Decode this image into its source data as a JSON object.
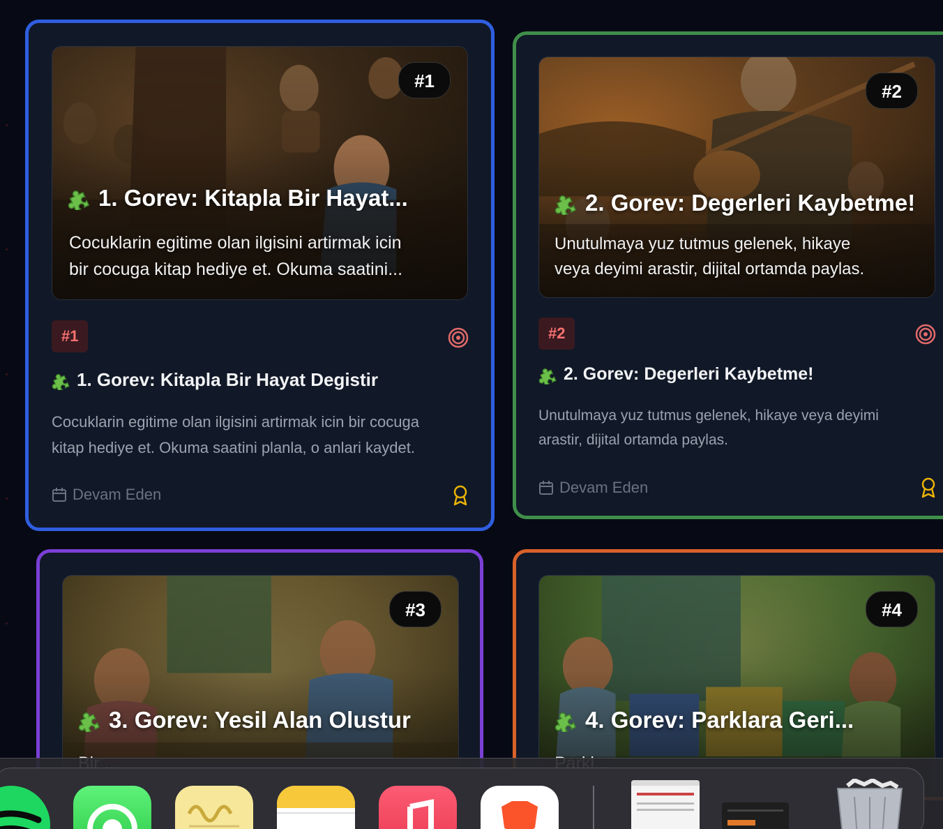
{
  "tasks": [
    {
      "rank": "#1",
      "hero_title": "1. Gorev: Kitapla Bir Hayat...",
      "hero_desc_line1": "Cocuklarin egitime olan ilgisini artirmak icin",
      "hero_desc_line2": "bir cocuga kitap hediye et. Okuma saatini...",
      "tag": "#1",
      "title": "1. Gorev: Kitapla Bir Hayat Degistir",
      "desc_line1": "Cocuklarin egitime olan ilgisini artirmak icin bir cocuga",
      "desc_line2": "kitap hediye et. Okuma saatini planla, o anlari kaydet.",
      "status": "Devam Eden",
      "border_color": "#2f5ee0"
    },
    {
      "rank": "#2",
      "hero_title": "2. Gorev: Degerleri Kaybetme!",
      "hero_desc_line1": "Unutulmaya yuz tutmus gelenek, hikaye",
      "hero_desc_line2": "veya deyimi arastir, dijital ortamda paylas.",
      "tag": "#2",
      "title": "2. Gorev: Degerleri Kaybetme!",
      "desc_line1": "Unutulmaya yuz tutmus gelenek, hikaye veya deyimi",
      "desc_line2": "arastir, dijital ortamda paylas.",
      "status": "Devam Eden",
      "border_color": "#3f8f4a"
    },
    {
      "rank": "#3",
      "hero_title": "3. Gorev: Yesil Alan Olustur",
      "hero_desc_line1": "Bir ...",
      "border_color": "#7b3fd6"
    },
    {
      "rank": "#4",
      "hero_title": "4. Gorev: Parklara Geri...",
      "hero_desc_line1": "Parkl...",
      "border_color": "#d9622b"
    }
  ],
  "dock": {
    "apps": [
      "Spotify",
      "WhatsApp",
      "Freeform",
      "Notes",
      "Music",
      "Brave"
    ],
    "trash": "Trash"
  },
  "colors": {
    "background": "#070a14",
    "card": "#111827",
    "tag_bg": "#3a1a20",
    "tag_text": "#f87171",
    "award": "#eab308"
  }
}
